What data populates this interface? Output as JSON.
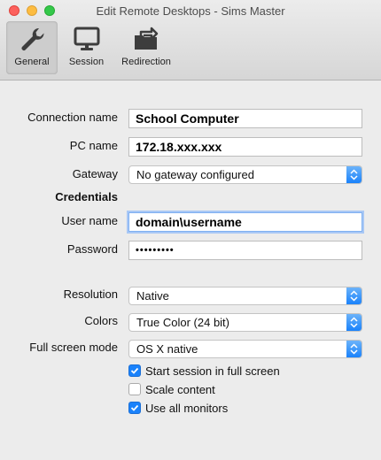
{
  "window": {
    "title": "Edit Remote Desktops - Sims Master"
  },
  "toolbar": {
    "items": [
      {
        "label": "General",
        "icon": "wrench-icon",
        "active": true
      },
      {
        "label": "Session",
        "icon": "monitor-icon",
        "active": false
      },
      {
        "label": "Redirection",
        "icon": "folder-redirect-icon",
        "active": false
      }
    ]
  },
  "form": {
    "connection_name": {
      "label": "Connection name",
      "value": "School Computer"
    },
    "pc_name": {
      "label": "PC name",
      "value": "172.18.xxx.xxx"
    },
    "gateway": {
      "label": "Gateway",
      "value": "No gateway configured"
    },
    "credentials_header": "Credentials",
    "user_name": {
      "label": "User name",
      "value": "domain\\username"
    },
    "password": {
      "label": "Password",
      "value": "•••••••••"
    },
    "resolution": {
      "label": "Resolution",
      "value": "Native"
    },
    "colors": {
      "label": "Colors",
      "value": "True Color (24 bit)"
    },
    "full_screen_mode": {
      "label": "Full screen mode",
      "value": "OS X native"
    },
    "checkboxes": [
      {
        "label": "Start session in full screen",
        "checked": true
      },
      {
        "label": "Scale content",
        "checked": false
      },
      {
        "label": "Use all monitors",
        "checked": true
      }
    ]
  },
  "colors": {
    "accent": "#1a82fb"
  }
}
